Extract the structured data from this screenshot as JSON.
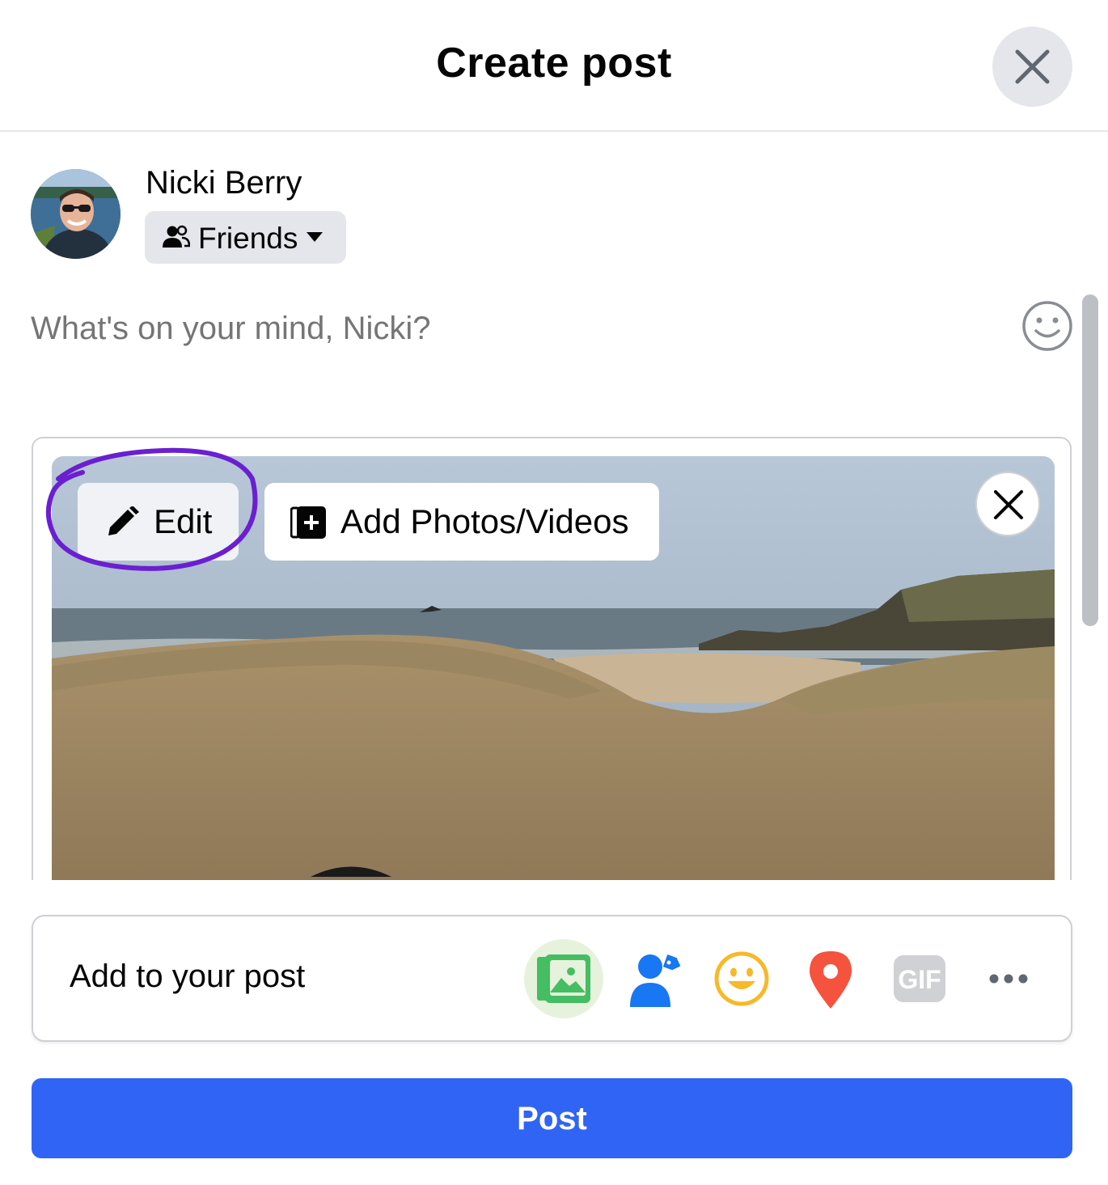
{
  "dialog": {
    "title": "Create post"
  },
  "user": {
    "name": "Nicki Berry"
  },
  "audience": {
    "label": "Friends"
  },
  "composer": {
    "placeholder": "What's on your mind, Nicki?"
  },
  "media": {
    "edit_label": "Edit",
    "add_label": "Add Photos/Videos"
  },
  "add_to_post": {
    "label": "Add to your post",
    "icons": [
      "photo-video-icon",
      "tag-people-icon",
      "feeling-icon",
      "check-in-icon",
      "gif-icon",
      "more-icon"
    ],
    "gif_text": "GIF"
  },
  "post_button": {
    "label": "Post"
  },
  "colors": {
    "primary": "#3064f5",
    "photo_green": "#45bd62",
    "tag_blue": "#1877f2",
    "feeling_yellow": "#f7b928",
    "checkin_red": "#f5533d",
    "highlight_purple": "#6a1fd0"
  }
}
